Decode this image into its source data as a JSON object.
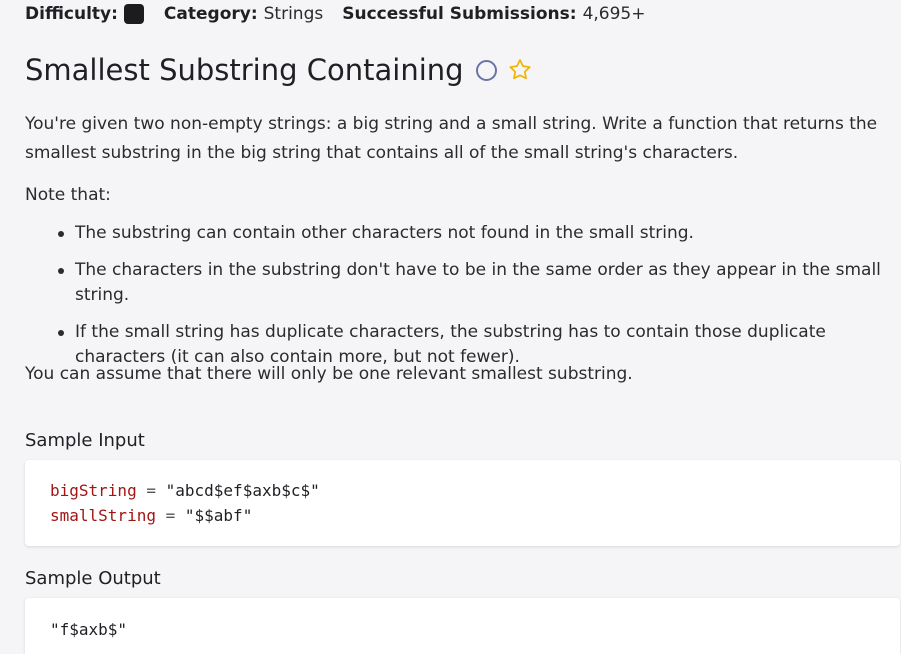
{
  "meta": {
    "difficulty_label": "Difficulty:",
    "category_label": "Category:",
    "category_value": "Strings",
    "submissions_label": "Successful Submissions:",
    "submissions_value": "4,695+"
  },
  "problem": {
    "title": "Smallest Substring Containing",
    "description": "You're given two non-empty strings: a big string and a small string. Write a function that returns the smallest substring in the big string that contains all of the small string's characters.",
    "note_intro": "Note that:",
    "notes": [
      "The substring can contain other characters not found in the small string.",
      "The characters in the substring don't have to be in the same order as they appear in the small string.",
      "If the small string has duplicate characters, the substring has to contain those duplicate characters (it can also contain more, but not fewer)."
    ],
    "assumption": "You can assume that there will only be one relevant smallest substring."
  },
  "sample_input": {
    "heading": "Sample Input",
    "lines": [
      {
        "name": "bigString",
        "op": "=",
        "value": "\"abcd$ef$axb$c$\""
      },
      {
        "name": "smallString",
        "op": "=",
        "value": "\"$$abf\""
      }
    ]
  },
  "sample_output": {
    "heading": "Sample Output",
    "value": "\"f$axb$\""
  },
  "icons": {
    "status": "circle-outline-icon",
    "favorite": "star-outline-icon"
  },
  "colors": {
    "star": "#f0b400",
    "status_circle": "#6b73a3",
    "variable": "#a31515"
  }
}
